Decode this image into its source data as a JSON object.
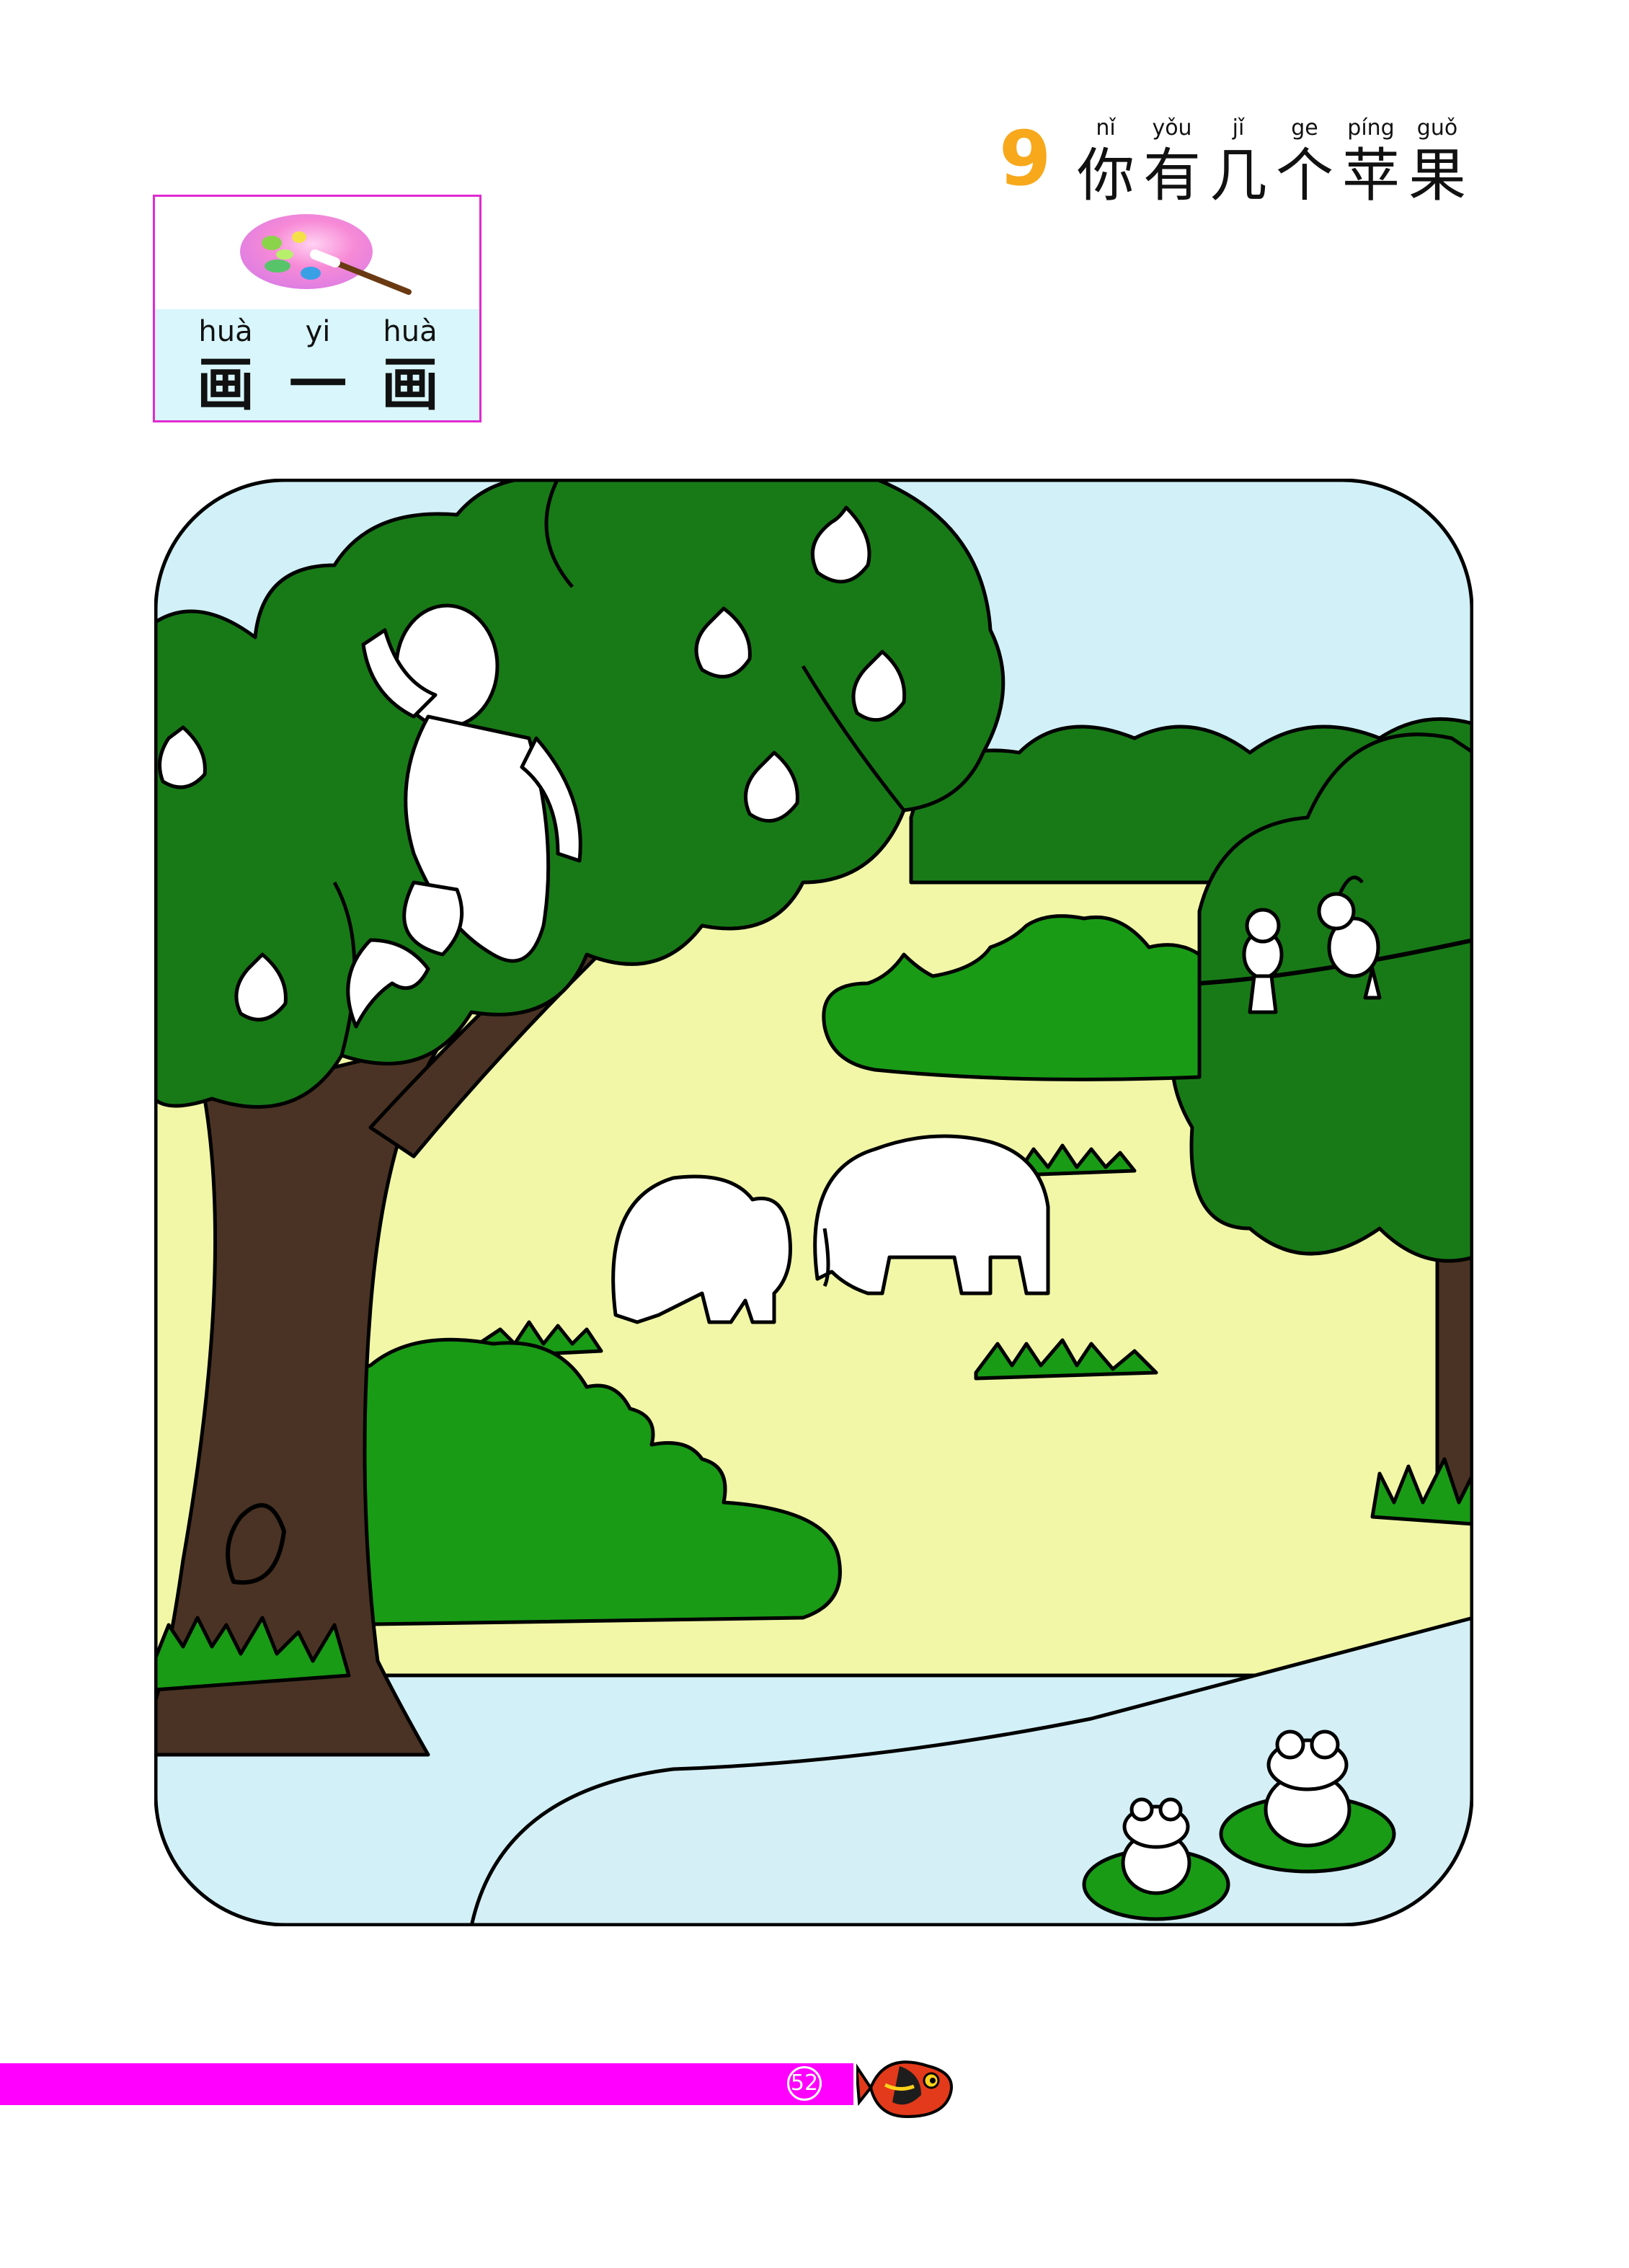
{
  "lesson": {
    "number": "9",
    "title_chars": [
      {
        "pinyin": "nǐ",
        "hanzi": "你"
      },
      {
        "pinyin": "yǒu",
        "hanzi": "有"
      },
      {
        "pinyin": "jǐ",
        "hanzi": "几"
      },
      {
        "pinyin": "ge",
        "hanzi": "个"
      },
      {
        "pinyin": "píng",
        "hanzi": "苹"
      },
      {
        "pinyin": "guǒ",
        "hanzi": "果"
      }
    ]
  },
  "activity": {
    "chars": [
      {
        "pinyin": "huà",
        "hanzi": "画"
      },
      {
        "pinyin": "yi",
        "hanzi": "一"
      },
      {
        "pinyin": "huà",
        "hanzi": "画"
      }
    ]
  },
  "colors": {
    "title_number": "#f7a81b",
    "box_border": "#e02ad2",
    "band": "#d8f6fb",
    "footer": "#ff00ff",
    "sky": "#d2f0f7",
    "meadow": "#f1f7a6",
    "tree_green": "#187a17",
    "bush_green": "#199b16",
    "trunk": "#4a3324",
    "water": "#d4f0f6"
  },
  "footer": {
    "page_number": "52"
  }
}
